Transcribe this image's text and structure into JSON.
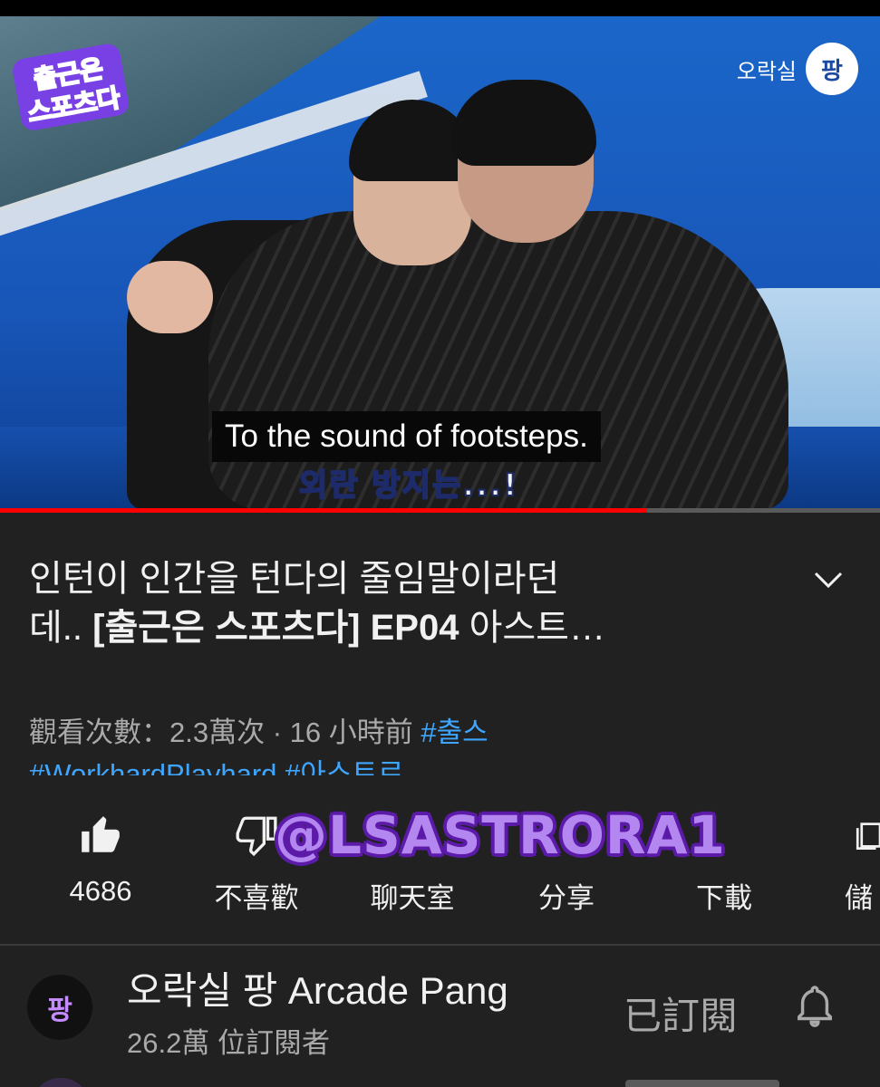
{
  "video": {
    "caption": "To the sound of footsteps.",
    "burned_subtitle": "외란 방지는...!",
    "show_logo": "출근은 스포츠다",
    "brand_text": "오락실",
    "brand_mark": "팡",
    "progress_fraction": 0.735,
    "progress_color": "#ff0000"
  },
  "title": {
    "line1": "인턴이 인간을 턴다의 줄임말이라던",
    "line2_prefix": "데.. ",
    "line2_bold": "[출근은 스포츠다] EP04",
    "line2_suffix": " 아스트…"
  },
  "meta": {
    "views": "觀看次數：2.3萬次",
    "sep": " · ",
    "age": "16 小時前",
    "tag1": "#출스",
    "tag2": "#WorkhardPlayhard",
    "tag3": "#아스트로"
  },
  "actions": {
    "like_count": "4686",
    "dislike": "不喜歡",
    "chat": "聊天室",
    "share": "分享",
    "download": "下載",
    "save": "儲"
  },
  "watermark": "@LSASTRORA1",
  "channel": {
    "avatar_text": "팡",
    "name": "오락실 팡 Arcade Pang",
    "subscribers": "26.2萬 位訂閱者",
    "subscribed_label": "已訂閱"
  },
  "icons": {
    "like": "thumbs-up-icon",
    "dislike": "thumbs-down-icon",
    "save": "save-to-playlist-icon",
    "expand": "chevron-down-icon",
    "bell": "bell-icon"
  },
  "colors": {
    "background": "#212121",
    "text_primary": "#f1f1f1",
    "text_secondary": "#aaaaaa",
    "hashtag": "#3ea6ff",
    "watermark_fill": "#b487f0",
    "watermark_outline": "#5c1aa8"
  }
}
